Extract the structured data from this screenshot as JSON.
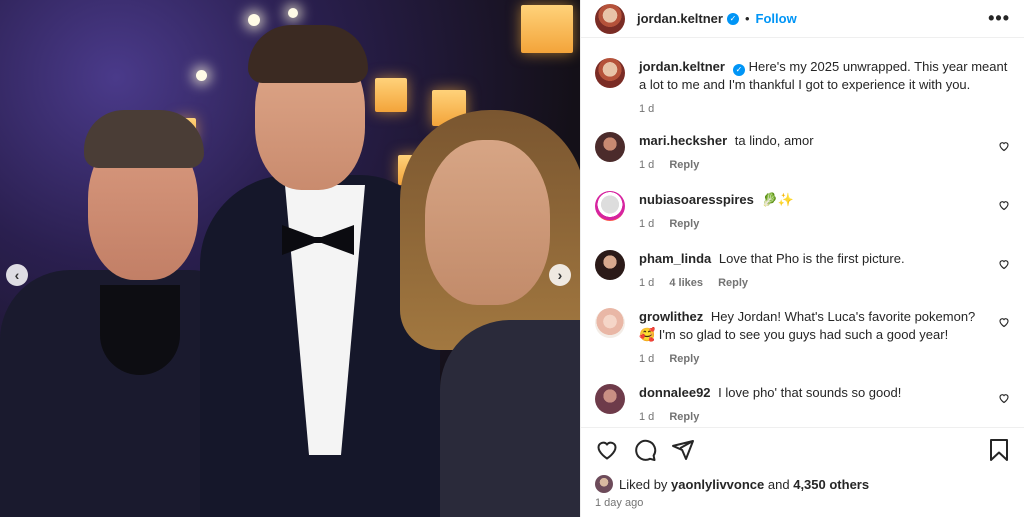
{
  "post": {
    "author": "jordan.keltner",
    "follow_label": "Follow",
    "separator": "•",
    "more_label": "•••",
    "caption": "Here's my 2025 unwrapped. This year meant a lot to me and I'm thankful I got to experience it with you.",
    "caption_time": "1 d"
  },
  "comments": [
    {
      "user": "mari.hecksher",
      "text": "ta lindo, amor",
      "time": "1 d",
      "likes": "",
      "reply": "Reply"
    },
    {
      "user": "nubiasoaresspires",
      "text": "🥬✨",
      "time": "1 d",
      "likes": "",
      "reply": "Reply"
    },
    {
      "user": "pham_linda",
      "text": "Love that Pho is the first picture.",
      "time": "1 d",
      "likes": "4 likes",
      "reply": "Reply"
    },
    {
      "user": "growlithez",
      "text": "Hey Jordan! What's Luca's favorite pokemon? 🥰 I'm so glad to see you guys had such a good year!",
      "time": "1 d",
      "likes": "",
      "reply": "Reply"
    },
    {
      "user": "donnalee92",
      "text": "I love pho' that sounds so good!",
      "time": "1 d",
      "likes": "",
      "reply": "Reply"
    }
  ],
  "likes": {
    "prefix": "Liked by",
    "user": "yaonlylivvonce",
    "middle": "and",
    "others": "4,350 others"
  },
  "date": "1 day ago",
  "photo": {
    "prev_label": "‹",
    "next_label": "›"
  },
  "colors": {
    "accent": "#0095f6",
    "text": "#262626",
    "muted": "#737373"
  },
  "icons": [
    "verified-badge-icon",
    "more-options-icon",
    "heart-icon",
    "comment-icon",
    "share-icon",
    "bookmark-icon",
    "chevron-left-icon",
    "chevron-right-icon"
  ]
}
